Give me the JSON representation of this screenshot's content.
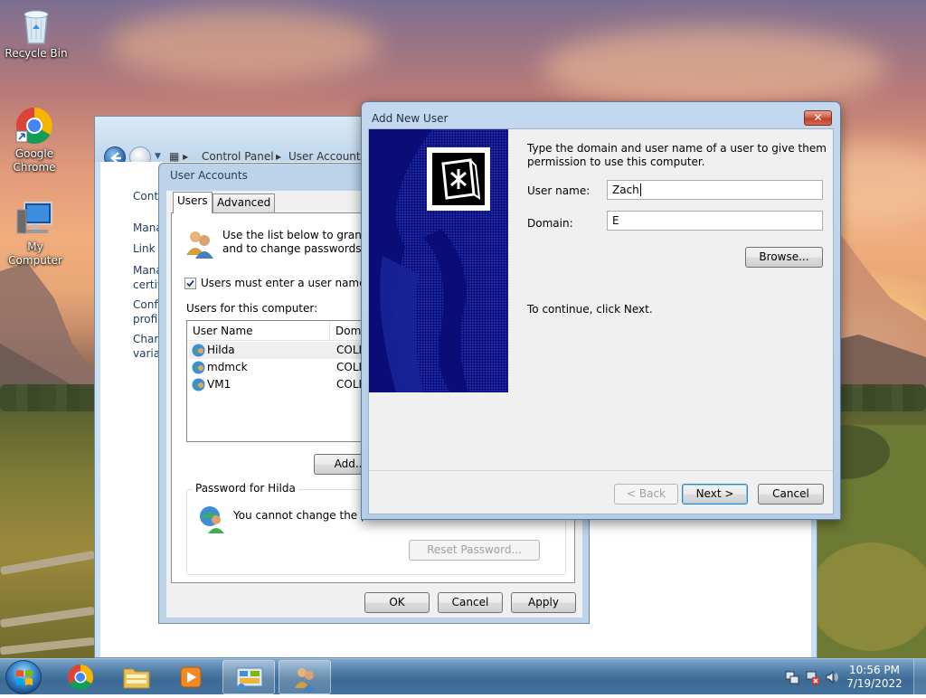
{
  "desktop": {
    "icons": [
      {
        "label": "Recycle Bin"
      },
      {
        "label": "Google\nChrome"
      },
      {
        "label": "My Computer"
      }
    ]
  },
  "control_panel": {
    "breadcrumb": [
      "Control Panel",
      "User Accounts"
    ],
    "tasks": [
      "Contro",
      "Manag",
      "Link or",
      "Manag\ncertific",
      "Config\nprofile",
      "Chang\nvariabl"
    ]
  },
  "user_accounts": {
    "title": "User Accounts",
    "tabs": [
      "Users",
      "Advanced"
    ],
    "intro_line1": "Use the list below to grant o",
    "intro_line2": "and to change passwords ar",
    "must_enter_label": "Users must enter a user name and",
    "must_enter_checked": true,
    "users_for_label": "Users for this computer:",
    "columns": [
      "User Name",
      "Doma"
    ],
    "users": [
      {
        "name": "Hilda",
        "domain": "COLL"
      },
      {
        "name": "mdmck",
        "domain": "COLL"
      },
      {
        "name": "VM1",
        "domain": "COLL"
      }
    ],
    "add_button": "Add...",
    "password_group": "Password for Hilda",
    "cannot_change_text": "You cannot change the p",
    "reset_password_button": "Reset Password...",
    "ok_button": "OK",
    "cancel_button": "Cancel",
    "apply_button": "Apply"
  },
  "add_new_user": {
    "title": "Add New User",
    "close": "✕",
    "instruction_line1": "Type the domain and user name of a user to give them",
    "instruction_line2": "permission to use this computer.",
    "user_name_label": "User name:",
    "user_name_value": "Zach",
    "domain_label": "Domain:",
    "domain_value": "E",
    "browse_button": "Browse...",
    "continue_text": "To continue, click Next.",
    "back_button": "< Back",
    "next_button": "Next >",
    "cancel_button": "Cancel"
  },
  "taskbar": {
    "time": "10:56 PM",
    "date": "7/19/2022"
  }
}
